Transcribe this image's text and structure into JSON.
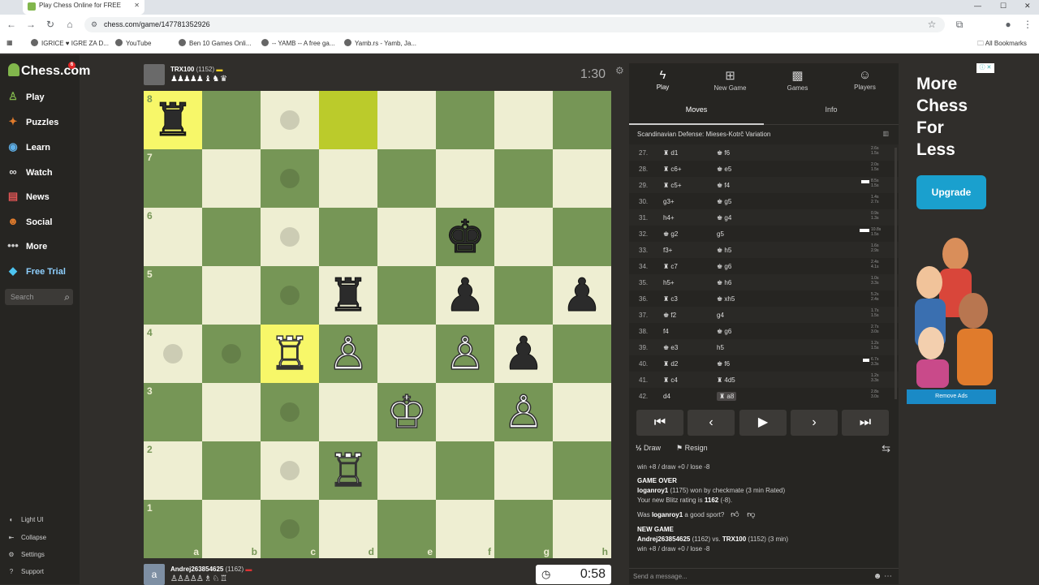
{
  "browser": {
    "tab_title": "Play Chess Online for FREE",
    "url": "chess.com/game/147781352926",
    "bookmarks": [
      "IGRICE ♥ IGRE ZA D...",
      "YouTube",
      "Ben 10 Games Onli...",
      "-- YAMB -- A free ga...",
      "Yamb.rs - Yamb, Ja..."
    ],
    "all_bookmarks": "All Bookmarks"
  },
  "sidebar": {
    "logo": "Chess.com",
    "logo_badge": "6",
    "items": [
      {
        "label": "Play",
        "icon": "play-icon"
      },
      {
        "label": "Puzzles",
        "icon": "puzzle-icon"
      },
      {
        "label": "Learn",
        "icon": "learn-icon"
      },
      {
        "label": "Watch",
        "icon": "binoculars-icon"
      },
      {
        "label": "News",
        "icon": "news-icon"
      },
      {
        "label": "Social",
        "icon": "social-icon"
      },
      {
        "label": "More",
        "icon": "more-icon"
      },
      {
        "label": "Free Trial",
        "icon": "diamond-icon"
      }
    ],
    "search_placeholder": "Search",
    "footer": [
      {
        "label": "Light UI",
        "icon": "lightbulb-icon"
      },
      {
        "label": "Collapse",
        "icon": "collapse-icon"
      },
      {
        "label": "Settings",
        "icon": "gear-icon"
      },
      {
        "label": "Support",
        "icon": "help-icon"
      }
    ]
  },
  "opponent": {
    "name": "TRX100",
    "rating": "(1152)",
    "clock": "1:30",
    "captured": "♟♟♟♟♟ ♝ ♞ ♛"
  },
  "player": {
    "name": "Andrej263854625",
    "rating": "(1162)",
    "clock": "0:58",
    "avatar_letter": "a",
    "captured": "♙♙♙♙♙ ♗ ♘ ♖"
  },
  "board": {
    "ranks": [
      "8",
      "7",
      "6",
      "5",
      "4",
      "3",
      "2",
      "1"
    ],
    "files": [
      "a",
      "b",
      "c",
      "d",
      "e",
      "f",
      "g",
      "h"
    ],
    "pieces": [
      {
        "sq": "a8",
        "p": "♜",
        "c": "b"
      },
      {
        "sq": "f6",
        "p": "♚",
        "c": "b"
      },
      {
        "sq": "d5",
        "p": "♜",
        "c": "b"
      },
      {
        "sq": "f5",
        "p": "♟",
        "c": "b"
      },
      {
        "sq": "h5",
        "p": "♟",
        "c": "b"
      },
      {
        "sq": "c4",
        "p": "♖",
        "c": "w"
      },
      {
        "sq": "d4",
        "p": "♙",
        "c": "w"
      },
      {
        "sq": "f4",
        "p": "♙",
        "c": "w"
      },
      {
        "sq": "g4",
        "p": "♟",
        "c": "b"
      },
      {
        "sq": "e3",
        "p": "♔",
        "c": "w"
      },
      {
        "sq": "g3",
        "p": "♙",
        "c": "w"
      },
      {
        "sq": "d2",
        "p": "♖",
        "c": "w"
      }
    ],
    "highlights": [
      "a8",
      "d8",
      "c4"
    ],
    "move_dots": [
      "c8",
      "c7",
      "c6",
      "c5",
      "a4",
      "b4",
      "c3",
      "c2",
      "c1"
    ]
  },
  "panel": {
    "tabs": [
      {
        "label": "Play",
        "icon": "lightning-icon"
      },
      {
        "label": "New Game",
        "icon": "plus-icon"
      },
      {
        "label": "Games",
        "icon": "games-icon"
      },
      {
        "label": "Players",
        "icon": "players-icon"
      }
    ],
    "subtabs": [
      "Moves",
      "Info"
    ],
    "opening": "Scandinavian Defense: Mieses-Kotrč Variation",
    "moves": [
      {
        "n": "27.",
        "w": "♜ d1",
        "b": "♚ f6",
        "t1": "2.6s",
        "t2": "1.5s",
        "wt": 0
      },
      {
        "n": "28.",
        "w": "♜ c6+",
        "b": "♚ e5",
        "t1": "2.0s",
        "t2": "1.5s",
        "wt": 0
      },
      {
        "n": "29.",
        "w": "♜ c5+",
        "b": "♚ f4",
        "t1": "8.5s",
        "t2": "1.5s",
        "wt": 10
      },
      {
        "n": "30.",
        "w": "g3+",
        "b": "♚ g5",
        "t1": "1.4s",
        "t2": "2.7s",
        "wt": 0
      },
      {
        "n": "31.",
        "w": "h4+",
        "b": "♚ g4",
        "t1": "0.9s",
        "t2": "1.3s",
        "wt": 0
      },
      {
        "n": "32.",
        "w": "♚ g2",
        "b": "g5",
        "t1": "10.8s",
        "t2": "1.5s",
        "wt": 12
      },
      {
        "n": "33.",
        "w": "f3+",
        "b": "♚ h5",
        "t1": "1.6s",
        "t2": "2.9s",
        "wt": 0
      },
      {
        "n": "34.",
        "w": "♜ c7",
        "b": "♚ g6",
        "t1": "2.4s",
        "t2": "4.1s",
        "wt": 0
      },
      {
        "n": "35.",
        "w": "h5+",
        "b": "♚ h6",
        "t1": "1.0s",
        "t2": "3.3s",
        "wt": 0
      },
      {
        "n": "36.",
        "w": "♜ c3",
        "b": "♚ xh5",
        "t1": "5.2s",
        "t2": "2.4s",
        "wt": 0
      },
      {
        "n": "37.",
        "w": "♚ f2",
        "b": "g4",
        "t1": "1.7s",
        "t2": "1.5s",
        "wt": 0
      },
      {
        "n": "38.",
        "w": "f4",
        "b": "♚ g6",
        "t1": "2.7s",
        "t2": "3.0s",
        "wt": 0
      },
      {
        "n": "39.",
        "w": "♚ e3",
        "b": "h5",
        "t1": "1.2s",
        "t2": "1.5s",
        "wt": 0
      },
      {
        "n": "40.",
        "w": "♜ d2",
        "b": "♚ f6",
        "t1": "6.7s",
        "t2": "3.3s",
        "wt": 8
      },
      {
        "n": "41.",
        "w": "♜ c4",
        "b": "♜ 4d5",
        "t1": "1.2s",
        "t2": "3.3s",
        "wt": 0
      },
      {
        "n": "42.",
        "w": "d4",
        "b": "♜ a8",
        "t1": "2.8s",
        "t2": "3.0s",
        "wt": 0
      }
    ],
    "controls": [
      "⏮",
      "‹",
      "▶",
      "›",
      "⏭"
    ],
    "draw": "Draw",
    "resign": "Resign",
    "chat": {
      "line0": "win +8 / draw +0 / lose -8",
      "gameover_title": "GAME OVER",
      "gameover_l1_name": "loganroy1",
      "gameover_l1_rest": " (1175) won by checkmate (3 min Rated)",
      "gameover_l2_pre": "Your new Blitz rating is ",
      "gameover_l2_val": "1162",
      "gameover_l2_post": " (-8).",
      "sport_pre": "Was ",
      "sport_name": "loganroy1",
      "sport_post": " a good sport?",
      "newgame_title": "NEW GAME",
      "newgame_p1": "Andrej263854625",
      "newgame_mid": " (1162) vs. ",
      "newgame_p2": "TRX100",
      "newgame_post": " (1152) (3 min)",
      "newgame_stakes": "win +8 / draw +0 / lose -8"
    },
    "message_placeholder": "Send a message..."
  },
  "ad": {
    "headline_lines": [
      "More",
      "Chess",
      "For",
      "Less"
    ],
    "button": "Upgrade",
    "remove": "Remove Ads",
    "info": "ⓘ ✕"
  },
  "colors": {
    "board_light": "#eeeed2",
    "board_dark": "#769656",
    "highlight": "#f7f769",
    "accent": "#81b64c"
  }
}
